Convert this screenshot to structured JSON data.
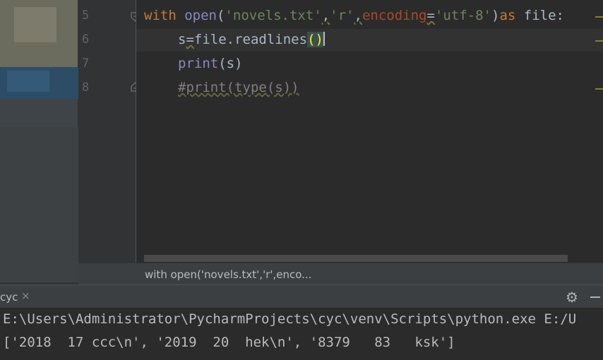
{
  "editor": {
    "line_numbers": [
      "5",
      "6",
      "7",
      "8"
    ],
    "line5": {
      "kw_with": "with",
      "fn_open": "open",
      "p1": "(",
      "str_file": "'novels.txt'",
      "comma1": ",",
      "str_mode": "'r'",
      "comma2": ",",
      "param_encoding": "encoding",
      "eq": "=",
      "str_enc": "'utf-8'",
      "p2": ")",
      "kw_as": "as",
      "rest": " file:"
    },
    "line6": {
      "var": "s",
      "eq": "=",
      "call": "file.readlines",
      "paren_open": "(",
      "paren_close": ")"
    },
    "line7": {
      "fn": "print",
      "args": "(s)"
    },
    "line8": {
      "comment": "#print(type(s))"
    }
  },
  "breadcrumb": "with open('novels.txt','r',enco...",
  "run_panel": {
    "tab_label": "cyc",
    "tab_close": "×",
    "settings_icon": "gear-icon",
    "minimize_icon": "minimize-icon",
    "console_lines": [
      "E:\\Users\\Administrator\\PycharmProjects\\cyc\\venv\\Scripts\\python.exe E:/U",
      "['2018  17 ccc\\n', '2019  20  hek\\n', '8379   83   ksk']"
    ]
  },
  "colors": {
    "keyword": "#cc7832",
    "builtin": "#8888c6",
    "string": "#6a8759",
    "param": "#aa4926",
    "comment": "#808080",
    "bracket_highlight": "#ffef28"
  }
}
